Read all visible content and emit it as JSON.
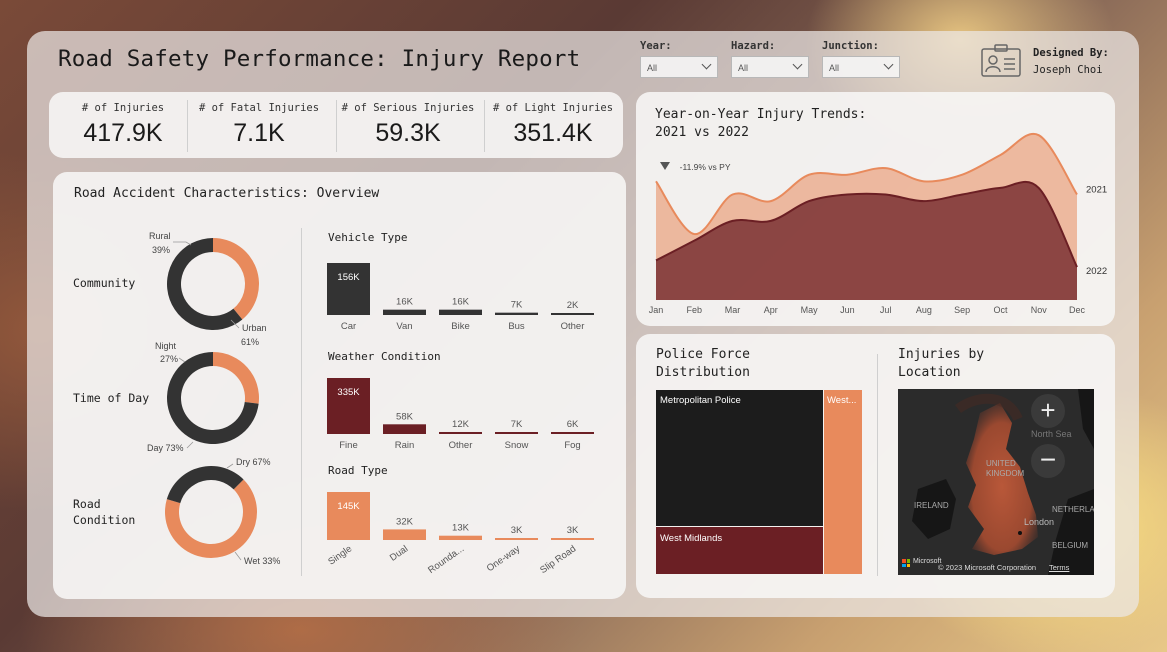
{
  "header": {
    "title": "Road Safety Performance: Injury Report",
    "slicers": [
      {
        "label": "Year:",
        "value": "All"
      },
      {
        "label": "Hazard:",
        "value": "All"
      },
      {
        "label": "Junction:",
        "value": "All"
      }
    ],
    "designer_label": "Designed By:",
    "designer_name": "Joseph Choi"
  },
  "kpis": [
    {
      "label": "# of Injuries",
      "value": "417.9K"
    },
    {
      "label": "# of Fatal Injuries",
      "value": "7.1K"
    },
    {
      "label": "# of Serious Injuries",
      "value": "59.3K"
    },
    {
      "label": "# of Light Injuries",
      "value": "351.4K"
    }
  ],
  "overview": {
    "title": "Road Accident Characteristics: Overview",
    "donuts": [
      {
        "label": "Community",
        "segments": [
          {
            "name": "Rural",
            "pct": "39%",
            "value": 39,
            "color": "#e88a5c"
          },
          {
            "name": "Urban",
            "pct": "61%",
            "value": 61,
            "color": "#333333"
          }
        ]
      },
      {
        "label": "Time of Day",
        "segments": [
          {
            "name": "Night",
            "pct": "27%",
            "value": 27,
            "color": "#e88a5c"
          },
          {
            "name": "Day",
            "pct": "73%",
            "value": 73,
            "color": "#333333"
          }
        ]
      },
      {
        "label": "Road Condition",
        "segments": [
          {
            "name": "Dry",
            "pct": "67%",
            "value": 67,
            "color": "#e88a5c"
          },
          {
            "name": "Wet",
            "pct": "33%",
            "value": 33,
            "color": "#333333"
          }
        ]
      }
    ],
    "donut_texts": {
      "rural": "Rural",
      "rural_pct": "39%",
      "urban": "Urban",
      "urban_pct": "61%",
      "night": "Night",
      "night_pct": "27%",
      "day": "Day 73%",
      "dry": "Dry 67%",
      "wet": "Wet 33%",
      "label_road": "Road",
      "label_condition": "Condition"
    }
  },
  "chart_data": [
    {
      "type": "bar",
      "title": "Vehicle Type",
      "categories": [
        "Car",
        "Van",
        "Bike",
        "Bus",
        "Other"
      ],
      "values": [
        156,
        16,
        16,
        7,
        2
      ],
      "labels": [
        "156K",
        "16K",
        "16K",
        "7K",
        "2K"
      ],
      "color": "#333333"
    },
    {
      "type": "bar",
      "title": "Weather Condition",
      "categories": [
        "Fine",
        "Rain",
        "Other",
        "Snow",
        "Fog"
      ],
      "values": [
        335,
        58,
        12,
        7,
        6
      ],
      "labels": [
        "335K",
        "58K",
        "12K",
        "7K",
        "6K"
      ],
      "color": "#6b1f24"
    },
    {
      "type": "bar",
      "title": "Road Type",
      "categories": [
        "Single",
        "Dual",
        "Rounda...",
        "One-way",
        "Slip Road"
      ],
      "values": [
        145,
        32,
        13,
        3,
        3
      ],
      "labels": [
        "145K",
        "32K",
        "13K",
        "3K",
        "3K"
      ],
      "color": "#e88a5c"
    },
    {
      "type": "area",
      "title": "Year-on-Year Injury Trends:",
      "subtitle": "2021 vs 2022",
      "categories": [
        "Jan",
        "Feb",
        "Mar",
        "Apr",
        "May",
        "Jun",
        "Jul",
        "Aug",
        "Sep",
        "Oct",
        "Nov",
        "Dec"
      ],
      "series": [
        {
          "name": "2021",
          "values": [
            33,
            25,
            31,
            30,
            34,
            34,
            35,
            33,
            34,
            37,
            40,
            31
          ],
          "color": "#e88a5c"
        },
        {
          "name": "2022",
          "values": [
            21,
            24,
            27,
            27,
            30,
            31,
            31,
            30,
            31,
            32,
            32,
            20
          ],
          "color": "#6b1f24"
        }
      ],
      "kpi_note": "-11.9% vs PY"
    },
    {
      "type": "treemap",
      "title": "Police Force Distribution",
      "items": [
        {
          "name": "Metropolitan Police",
          "color": "#1c1c1c"
        },
        {
          "name": "West Midlands",
          "color": "#6b1f24"
        },
        {
          "name": "West...",
          "color": "#e88a5c"
        }
      ]
    }
  ],
  "map": {
    "title": "Injuries by Location",
    "labels": {
      "north_sea": "North Sea",
      "united_kingdom": "UNITED KINGDOM",
      "ireland": "IRELAND",
      "netherlands": "NETHERLANDS",
      "london": "London",
      "belgium": "BELGIUM"
    },
    "attribution": "© 2023 Microsoft Corporation",
    "terms": "Terms",
    "brand": "Microsoft"
  }
}
